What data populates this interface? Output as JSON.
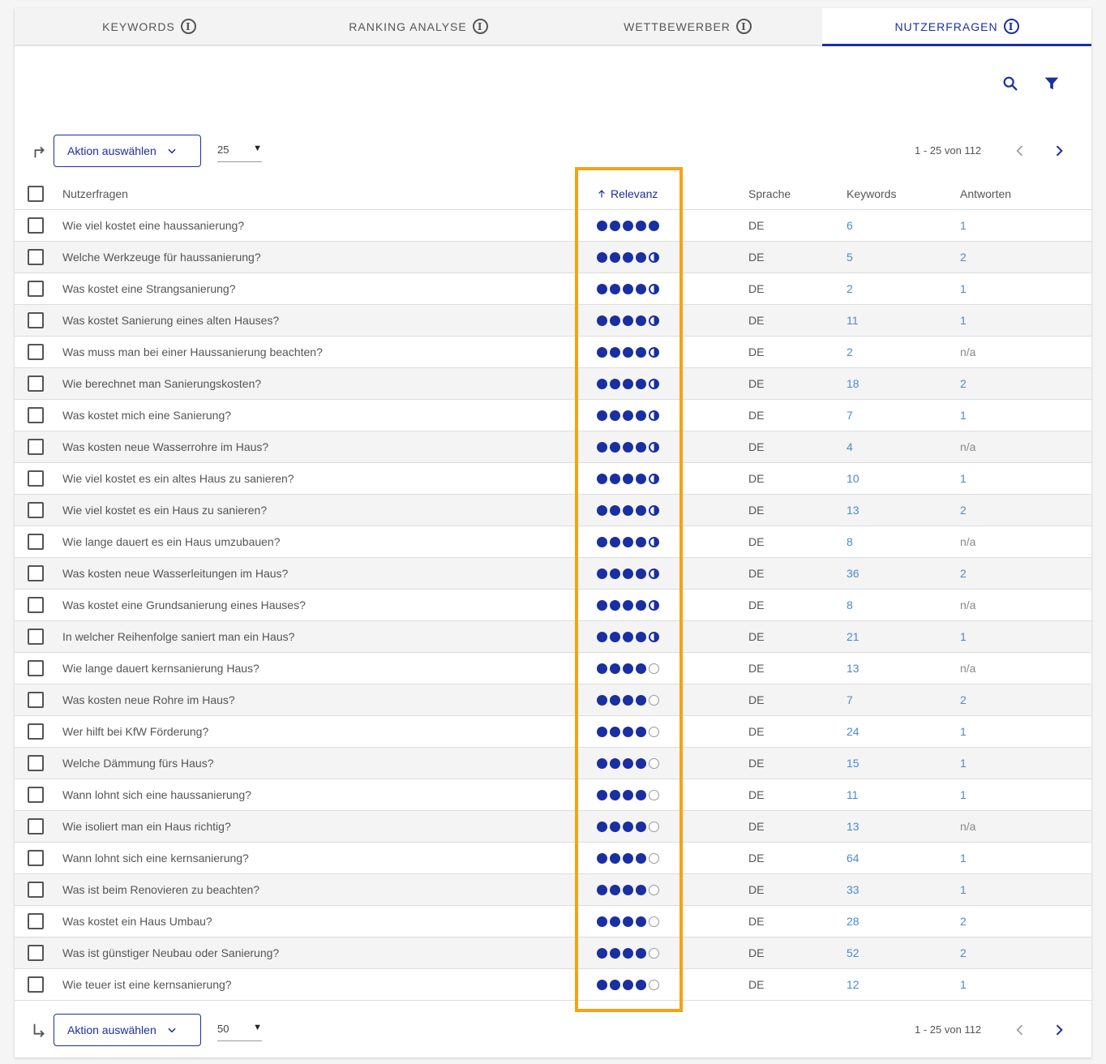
{
  "tabs": [
    {
      "label": "KEYWORDS"
    },
    {
      "label": "RANKING ANALYSE"
    },
    {
      "label": "WETTBEWERBER"
    },
    {
      "label": "NUTZERFRAGEN"
    }
  ],
  "active_tab": 3,
  "colors": {
    "primary": "#1a2fa0",
    "link": "#4a8ad0",
    "highlight": "#f5a213"
  },
  "toolbar_top": {
    "action_label": "Aktion auswählen",
    "per_page": "25",
    "page_info": "1 - 25 von 112"
  },
  "toolbar_bottom": {
    "action_label": "Aktion auswählen",
    "per_page": "50",
    "page_info": "1 - 25 von 112"
  },
  "table": {
    "headers": {
      "question": "Nutzerfragen",
      "relevance": "Relevanz",
      "language": "Sprache",
      "keywords": "Keywords",
      "answers": "Antworten"
    },
    "rows": [
      {
        "question": "Wie viel kostet eine haussanierung?",
        "relevance": 5,
        "language": "DE",
        "keywords": "6",
        "answers": "1"
      },
      {
        "question": "Welche Werkzeuge für haussanierung?",
        "relevance": 4.5,
        "language": "DE",
        "keywords": "5",
        "answers": "2"
      },
      {
        "question": "Was kostet eine Strangsanierung?",
        "relevance": 4.5,
        "language": "DE",
        "keywords": "2",
        "answers": "1"
      },
      {
        "question": "Was kostet Sanierung eines alten Hauses?",
        "relevance": 4.5,
        "language": "DE",
        "keywords": "11",
        "answers": "1"
      },
      {
        "question": "Was muss man bei einer Haussanierung beachten?",
        "relevance": 4.5,
        "language": "DE",
        "keywords": "2",
        "answers": "n/a"
      },
      {
        "question": "Wie berechnet man Sanierungskosten?",
        "relevance": 4.5,
        "language": "DE",
        "keywords": "18",
        "answers": "2"
      },
      {
        "question": "Was kostet mich eine Sanierung?",
        "relevance": 4.5,
        "language": "DE",
        "keywords": "7",
        "answers": "1"
      },
      {
        "question": "Was kosten neue Wasserrohre im Haus?",
        "relevance": 4.5,
        "language": "DE",
        "keywords": "4",
        "answers": "n/a"
      },
      {
        "question": "Wie viel kostet es ein altes Haus zu sanieren?",
        "relevance": 4.5,
        "language": "DE",
        "keywords": "10",
        "answers": "1"
      },
      {
        "question": "Wie viel kostet es ein Haus zu sanieren?",
        "relevance": 4.5,
        "language": "DE",
        "keywords": "13",
        "answers": "2"
      },
      {
        "question": "Wie lange dauert es ein Haus umzubauen?",
        "relevance": 4.5,
        "language": "DE",
        "keywords": "8",
        "answers": "n/a"
      },
      {
        "question": "Was kosten neue Wasserleitungen im Haus?",
        "relevance": 4.5,
        "language": "DE",
        "keywords": "36",
        "answers": "2"
      },
      {
        "question": "Was kostet eine Grundsanierung eines Hauses?",
        "relevance": 4.5,
        "language": "DE",
        "keywords": "8",
        "answers": "n/a"
      },
      {
        "question": "In welcher Reihenfolge saniert man ein Haus?",
        "relevance": 4.5,
        "language": "DE",
        "keywords": "21",
        "answers": "1"
      },
      {
        "question": "Wie lange dauert kernsanierung Haus?",
        "relevance": 4,
        "language": "DE",
        "keywords": "13",
        "answers": "n/a"
      },
      {
        "question": "Was kosten neue Rohre im Haus?",
        "relevance": 4,
        "language": "DE",
        "keywords": "7",
        "answers": "2"
      },
      {
        "question": "Wer hilft bei KfW Förderung?",
        "relevance": 4,
        "language": "DE",
        "keywords": "24",
        "answers": "1"
      },
      {
        "question": "Welche Dämmung fürs Haus?",
        "relevance": 4,
        "language": "DE",
        "keywords": "15",
        "answers": "1"
      },
      {
        "question": "Wann lohnt sich eine haussanierung?",
        "relevance": 4,
        "language": "DE",
        "keywords": "11",
        "answers": "1"
      },
      {
        "question": "Wie isoliert man ein Haus richtig?",
        "relevance": 4,
        "language": "DE",
        "keywords": "13",
        "answers": "n/a"
      },
      {
        "question": "Wann lohnt sich eine kernsanierung?",
        "relevance": 4,
        "language": "DE",
        "keywords": "64",
        "answers": "1"
      },
      {
        "question": "Was ist beim Renovieren zu beachten?",
        "relevance": 4,
        "language": "DE",
        "keywords": "33",
        "answers": "1"
      },
      {
        "question": "Was kostet ein Haus Umbau?",
        "relevance": 4,
        "language": "DE",
        "keywords": "28",
        "answers": "2"
      },
      {
        "question": "Was ist günstiger Neubau oder Sanierung?",
        "relevance": 4,
        "language": "DE",
        "keywords": "52",
        "answers": "2"
      },
      {
        "question": "Wie teuer ist eine kernsanierung?",
        "relevance": 4,
        "language": "DE",
        "keywords": "12",
        "answers": "1"
      }
    ]
  }
}
